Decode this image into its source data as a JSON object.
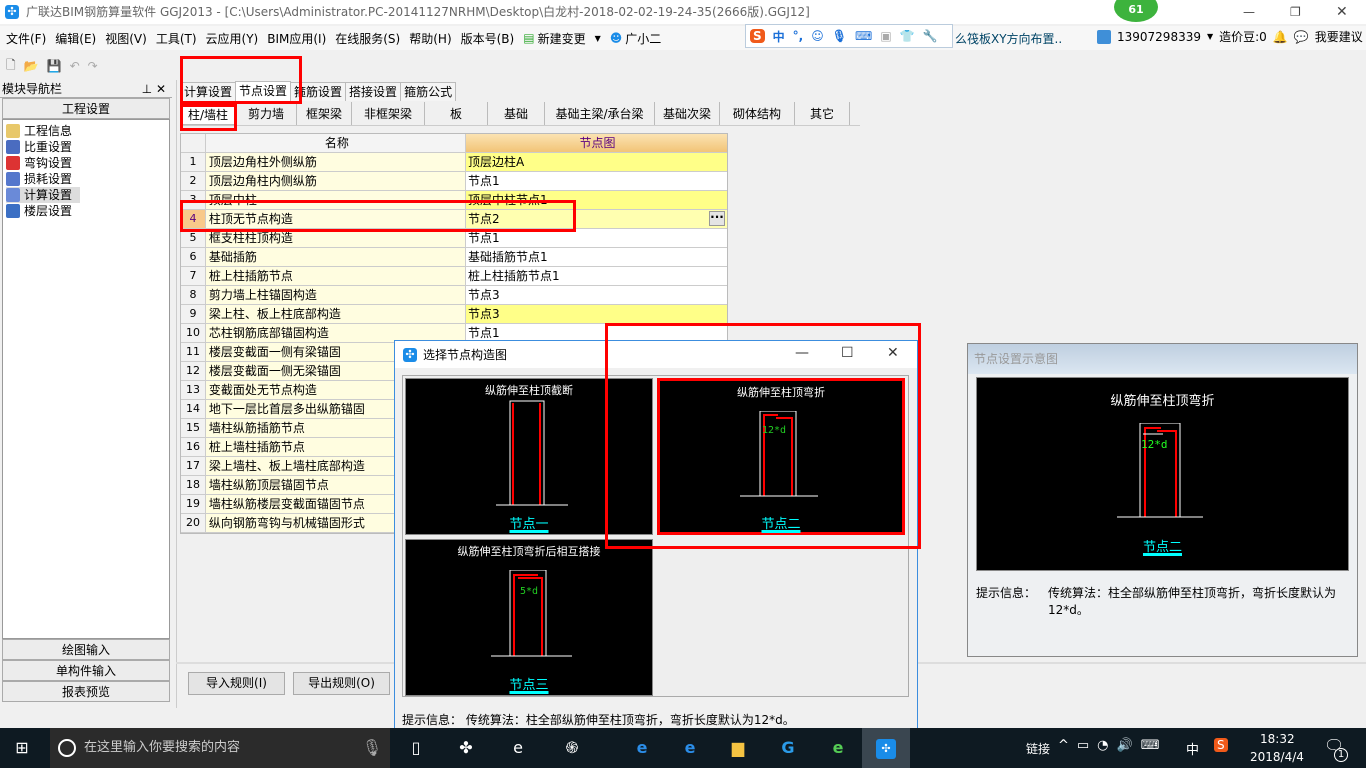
{
  "window": {
    "title": "广联达BIM钢筋算量软件 GGJ2013 - [C:\\Users\\Administrator.PC-20141127NRHM\\Desktop\\白龙村-2018-02-02-19-24-35(2666版).GGJ12]",
    "badge": "61"
  },
  "menu": [
    "文件(F)",
    "编辑(E)",
    "视图(V)",
    "工具(T)",
    "云应用(Y)",
    "BIM应用(I)",
    "在线服务(S)",
    "帮助(H)",
    "版本号(B)",
    "新建变更",
    "广小二"
  ],
  "ime": {
    "lang": "中",
    "ticker": "么筏板XY方向布置.."
  },
  "account": {
    "phone": "13907298339",
    "beans": "造价豆:0",
    "suggest": "我要建议"
  },
  "nav": {
    "title": "模块导航栏",
    "section": "工程设置",
    "items": [
      "工程信息",
      "比重设置",
      "弯钩设置",
      "损耗设置",
      "计算设置",
      "楼层设置"
    ],
    "selected": 4,
    "bottom": [
      "绘图输入",
      "单构件输入",
      "报表预览"
    ]
  },
  "tabs": [
    "计算设置",
    "节点设置",
    "箍筋设置",
    "搭接设置",
    "箍筋公式"
  ],
  "subtabs": [
    "柱/墙柱",
    "剪力墙",
    "框架梁",
    "非框架梁",
    "板",
    "基础",
    "基础主梁/承台梁",
    "基础次梁",
    "砌体结构",
    "其它"
  ],
  "grid": {
    "headers": [
      "名称",
      "节点图"
    ],
    "rows": [
      {
        "n": "1",
        "name": "顶层边角柱外侧纵筋",
        "val": "顶层边柱A",
        "hl": true
      },
      {
        "n": "2",
        "name": "顶层边角柱内侧纵筋",
        "val": "节点1"
      },
      {
        "n": "3",
        "name": "顶层中柱",
        "val": "顶层中柱节点1",
        "hl": true
      },
      {
        "n": "4",
        "name": "柱顶无节点构造",
        "val": "节点2",
        "cur": true
      },
      {
        "n": "5",
        "name": "框支柱柱顶构造",
        "val": "节点1"
      },
      {
        "n": "6",
        "name": "基础插筋",
        "val": "基础插筋节点1"
      },
      {
        "n": "7",
        "name": "桩上柱插筋节点",
        "val": "桩上柱插筋节点1"
      },
      {
        "n": "8",
        "name": "剪力墙上柱锚固构造",
        "val": "节点3"
      },
      {
        "n": "9",
        "name": "梁上柱、板上柱底部构造",
        "val": "节点3",
        "hl": true
      },
      {
        "n": "10",
        "name": "芯柱钢筋底部锚固构造",
        "val": "节点1"
      },
      {
        "n": "11",
        "name": "楼层变截面一侧有梁锚固",
        "val": ""
      },
      {
        "n": "12",
        "name": "楼层变截面一侧无梁锚固",
        "val": ""
      },
      {
        "n": "13",
        "name": "变截面处无节点构造",
        "val": ""
      },
      {
        "n": "14",
        "name": "地下一层比首层多出纵筋锚固",
        "val": ""
      },
      {
        "n": "15",
        "name": "墙柱纵筋插筋节点",
        "val": ""
      },
      {
        "n": "16",
        "name": "桩上墙柱插筋节点",
        "val": ""
      },
      {
        "n": "17",
        "name": "梁上墙柱、板上墙柱底部构造",
        "val": ""
      },
      {
        "n": "18",
        "name": "墙柱纵筋顶层锚固节点",
        "val": ""
      },
      {
        "n": "19",
        "name": "墙柱纵筋楼层变截面锚固节点",
        "val": ""
      },
      {
        "n": "20",
        "name": "纵向钢筋弯钩与机械锚固形式",
        "val": ""
      }
    ]
  },
  "buttons": {
    "import": "导入规则(I)",
    "export": "导出规则(O)"
  },
  "dialog": {
    "title": "选择节点构造图",
    "options": [
      {
        "title": "纵筋伸至柱顶截断",
        "label": "节点一"
      },
      {
        "title": "纵筋伸至柱顶弯折",
        "label": "节点二",
        "dim": "12*d",
        "selected": true
      },
      {
        "title": "纵筋伸至柱顶弯折后相互搭接",
        "label": "节点三",
        "dim": "5*d"
      }
    ],
    "hint": "提示信息： 传统算法：柱全部纵筋伸至柱顶弯折，弯折长度默认为12*d。"
  },
  "preview": {
    "title": "节点设置示意图",
    "diagram_title": "纵筋伸至柱顶弯折",
    "dim": "12*d",
    "label": "节点二",
    "hint_label": "提示信息：",
    "hint": "传统算法：柱全部纵筋伸至柱顶弯折，弯折长度默认为12*d。"
  },
  "taskbar": {
    "search": "在这里输入你要搜索的内容",
    "tray_link": "链接",
    "lang": "中",
    "time": "18:32",
    "date": "2018/4/4",
    "notifications": "1"
  }
}
